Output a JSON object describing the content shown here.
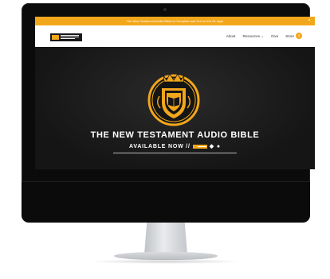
{
  "announcement": {
    "text": "The New Testament Audio Bible is Complete and Out on the GL App!",
    "close_icon": "close-icon"
  },
  "nav": {
    "links": [
      "About",
      "Resources ⌄",
      "Give",
      "Store"
    ],
    "cart_count": "0"
  },
  "hero": {
    "title": "THE NEW TESTAMENT AUDIO BIBLE",
    "subtitle": "AVAILABLE NOW //",
    "icons": [
      "app-logo",
      "android-icon",
      "apple-icon"
    ]
  },
  "colors": {
    "accent": "#f2a71b",
    "dark": "#1c1c1c"
  }
}
